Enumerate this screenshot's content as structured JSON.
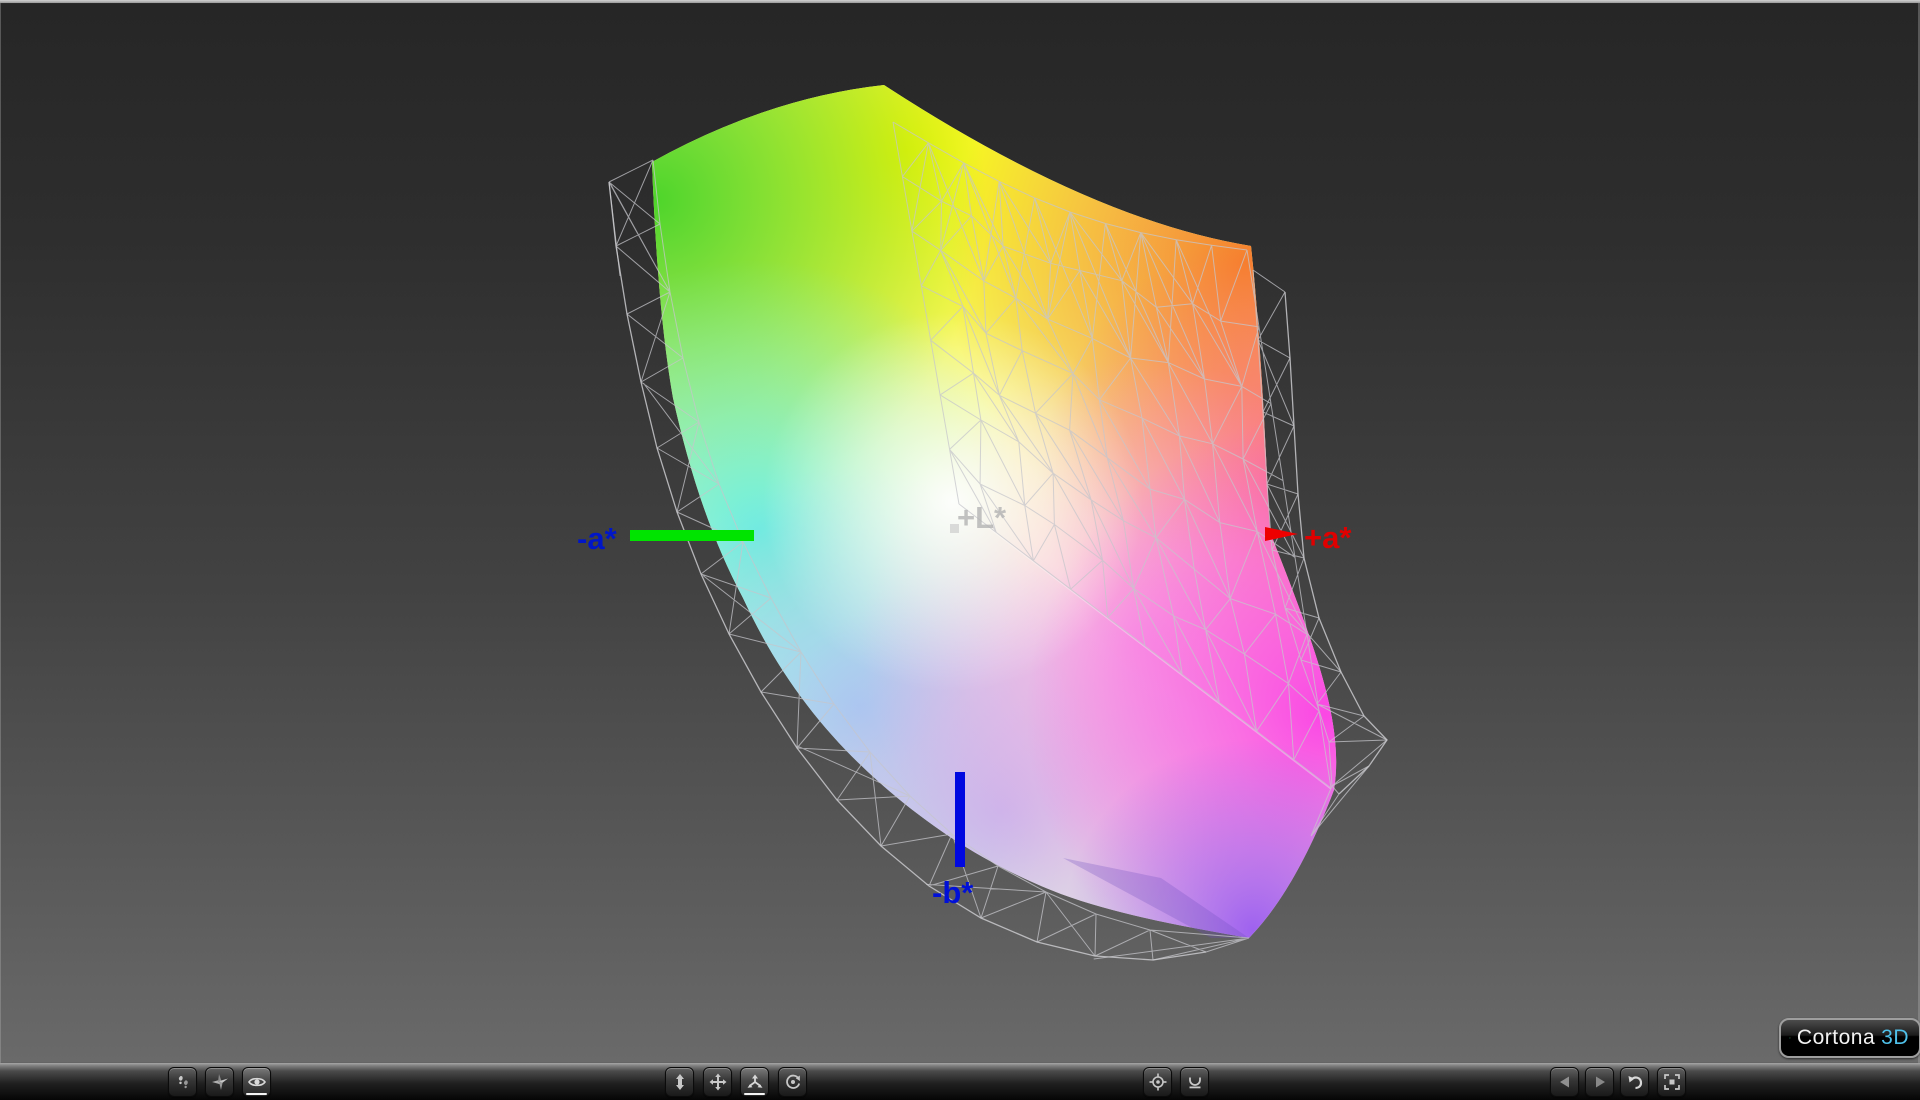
{
  "app": {
    "name": "Cortona3D",
    "brand_text": "Cortona",
    "brand_suffix": "3D",
    "brand_suffix_color": "#4fc1ea"
  },
  "axes": {
    "neg_a": {
      "label": "-a*",
      "label_color": "#0016c8",
      "axis_color": "#00e400"
    },
    "pos_a": {
      "label": "+a*",
      "label_color": "#e00000",
      "axis_color": "#ee0000"
    },
    "neg_b": {
      "label": "-b*",
      "label_color": "#0010d8",
      "axis_color": "#0008e0"
    },
    "pos_l": {
      "label": "+L*",
      "label_color": "#b4b4b4"
    }
  },
  "model": {
    "description": "3D CIE-Lab color gamut solid with wireframe comparison mesh",
    "mesh_color": "#c6c6cb",
    "gamut_colors": [
      "#52d82a",
      "#f6f600",
      "#f57b22",
      "#fb5f74",
      "#fb3fe4",
      "#9a5cf0",
      "#63efe0",
      "#9fc9f3",
      "#c3b2ec",
      "#f8a0e4",
      "#ffffff"
    ]
  },
  "background": {
    "top": "#262626",
    "bottom": "#6a6a6a",
    "top_strip": "#c8c8c8"
  },
  "toolbar": {
    "groups": [
      {
        "name": "navigation-mode",
        "buttons": [
          {
            "id": "walk",
            "icon": "footprints-icon",
            "selected": false
          },
          {
            "id": "fly",
            "icon": "fly-star-icon",
            "selected": false
          },
          {
            "id": "examine",
            "icon": "eye-icon",
            "selected": true
          }
        ]
      },
      {
        "name": "movement",
        "buttons": [
          {
            "id": "go-up-down",
            "icon": "vertical-arrows-icon",
            "selected": false
          },
          {
            "id": "pan",
            "icon": "pan-arrows-icon",
            "selected": false
          },
          {
            "id": "turn",
            "icon": "turn-arrows-icon",
            "selected": true
          },
          {
            "id": "spin",
            "icon": "orbit-arrow-icon",
            "selected": false
          }
        ]
      },
      {
        "name": "view-tools",
        "buttons": [
          {
            "id": "seek",
            "icon": "crosshair-icon",
            "selected": false
          },
          {
            "id": "straighten",
            "icon": "horizon-icon",
            "selected": false
          }
        ]
      },
      {
        "name": "viewpoints",
        "buttons": [
          {
            "id": "prev-viewpoint",
            "icon": "left-triangle-icon",
            "selected": false
          },
          {
            "id": "next-viewpoint",
            "icon": "right-triangle-icon",
            "selected": false
          },
          {
            "id": "restore-viewpoint",
            "icon": "undo-arrow-icon",
            "selected": false
          },
          {
            "id": "fit-window",
            "icon": "fit-frame-icon",
            "selected": false
          }
        ]
      }
    ]
  }
}
